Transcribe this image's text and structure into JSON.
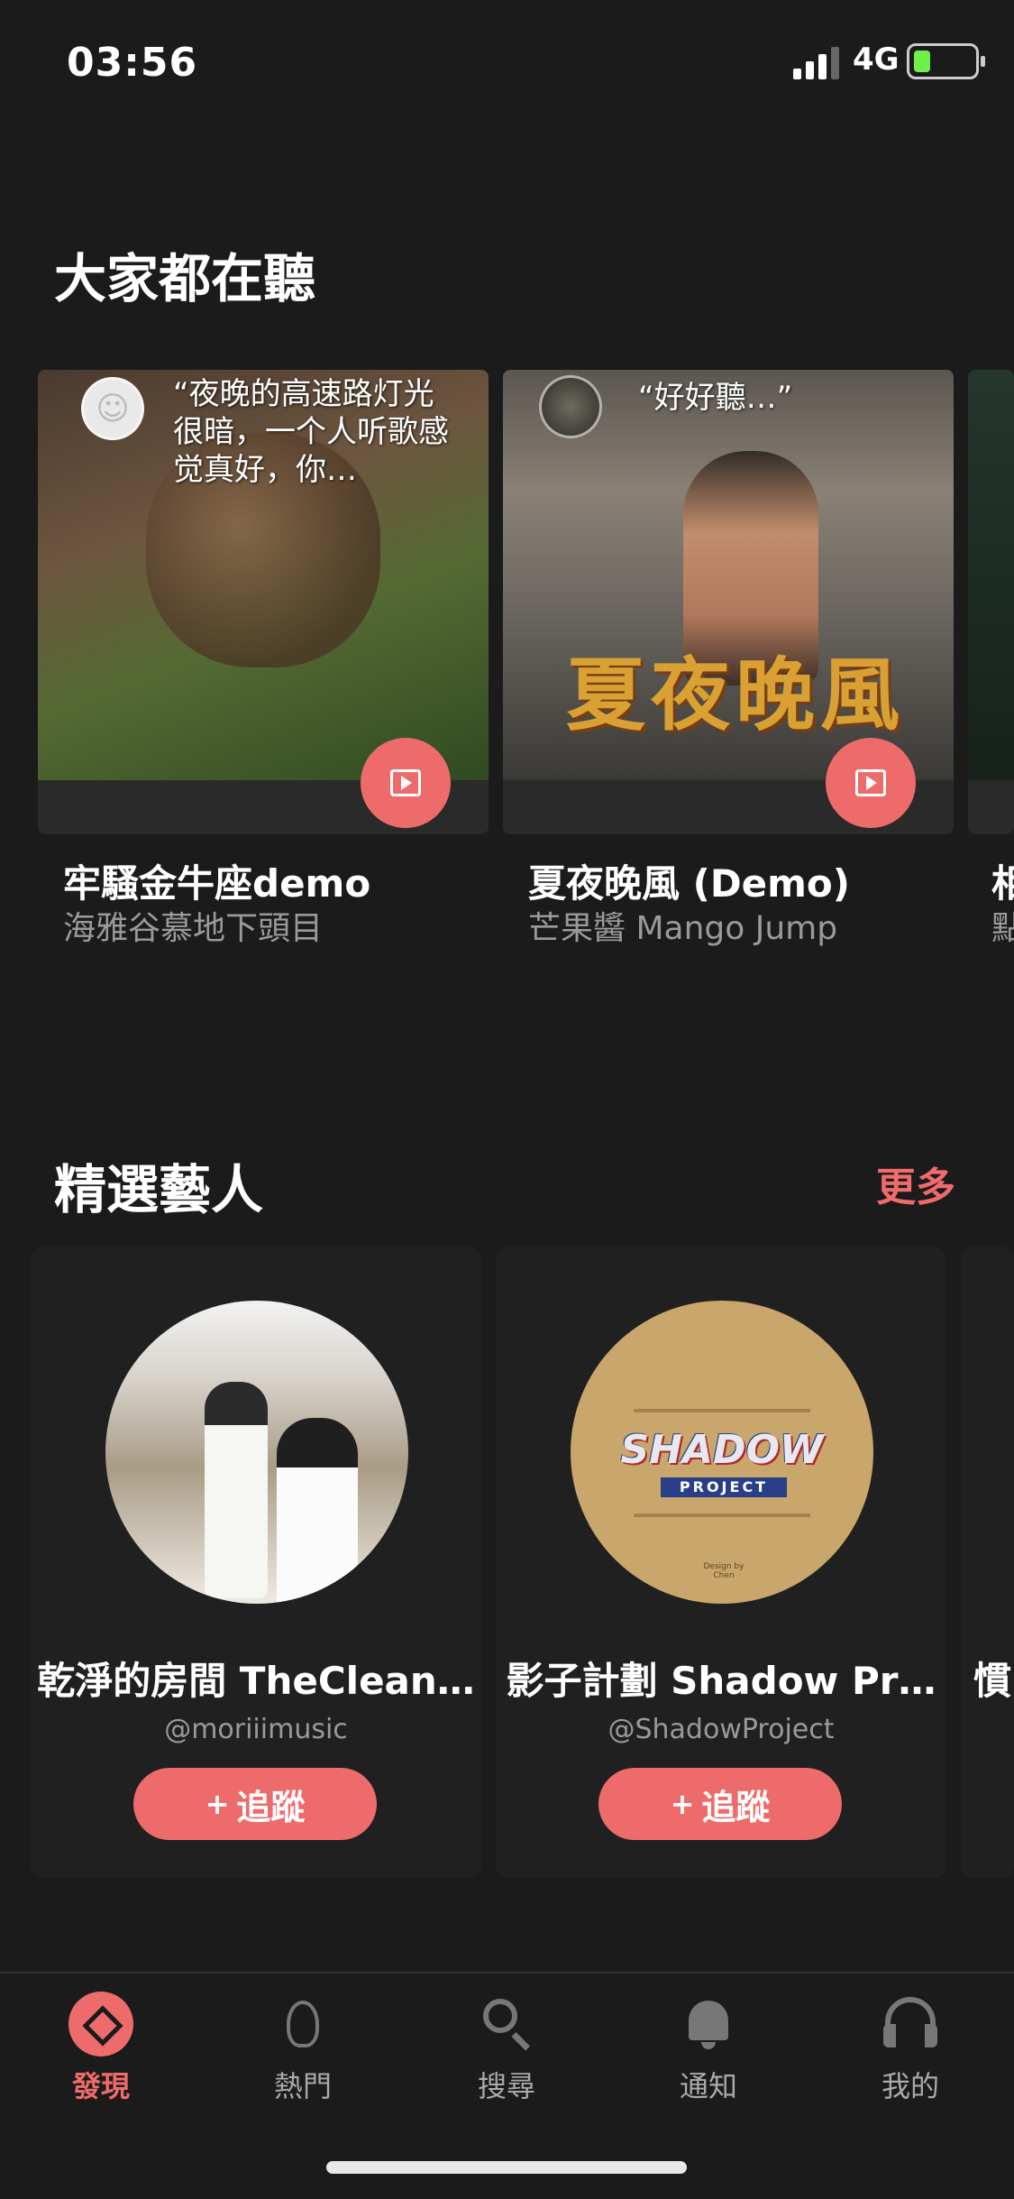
{
  "status": {
    "time": "03:56",
    "network": "4G"
  },
  "listening": {
    "title": "大家都在聽",
    "cards": [
      {
        "quote": "“夜晚的高速路灯光很暗，一个人听歌感觉真好，你…",
        "song": "牢騷金牛座demo",
        "artist": "海雅谷慕地下頭目"
      },
      {
        "quote": "“好好聽…”",
        "poster_text": "夏夜晚風",
        "song": "夏夜晚風 (Demo)",
        "artist": "芒果醬 Mango Jump"
      },
      {
        "song": "相",
        "artist": "點"
      }
    ]
  },
  "featured": {
    "title": "精選藝人",
    "more_label": "更多",
    "artists": [
      {
        "name": "乾淨的房間 TheClean…",
        "handle": "@moriiimusic",
        "follow_label": "追蹤"
      },
      {
        "name": "影子計劃 Shadow Pr…",
        "handle": "@ShadowProject",
        "follow_label": "追蹤",
        "logo_text": "SHADOW",
        "logo_sub": "PROJECT",
        "credit": "Design by Chen"
      },
      {
        "name": "慣"
      }
    ]
  },
  "tabs": [
    {
      "label": "發現",
      "icon": "discover-icon",
      "active": true
    },
    {
      "label": "熱門",
      "icon": "fire-icon",
      "active": false
    },
    {
      "label": "搜尋",
      "icon": "search-icon",
      "active": false
    },
    {
      "label": "通知",
      "icon": "bell-icon",
      "active": false
    },
    {
      "label": "我的",
      "icon": "headphones-icon",
      "active": false
    }
  ],
  "colors": {
    "accent": "#ee6b6b",
    "background": "#1b1b1b",
    "muted_text": "#9a9a9a"
  }
}
